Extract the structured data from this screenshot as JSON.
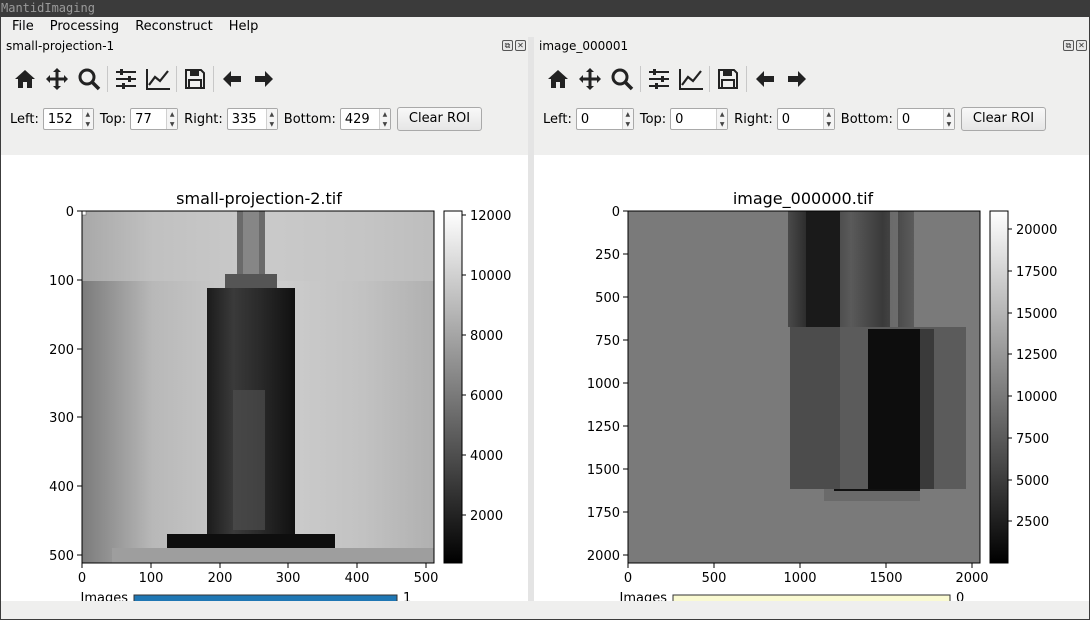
{
  "app_title": "MantidImaging",
  "menu": [
    "File",
    "Processing",
    "Reconstruct",
    "Help"
  ],
  "left": {
    "dock_title": "small-projection-1",
    "roi": {
      "left_label": "Left:",
      "left": "152",
      "top_label": "Top:",
      "top": "77",
      "right_label": "Right:",
      "right": "335",
      "bottom_label": "Bottom:",
      "bottom": "429",
      "clear_label": "Clear ROI"
    },
    "plot_title": "small-projection-2.tif",
    "x_ticks": [
      "0",
      "100",
      "200",
      "300",
      "400",
      "500"
    ],
    "y_ticks": [
      "0",
      "100",
      "200",
      "300",
      "400",
      "500"
    ],
    "cbar_ticks": [
      "12000",
      "10000",
      "8000",
      "6000",
      "4000",
      "2000"
    ],
    "slider_label": "Images",
    "slider_value": "1",
    "slider_color": "#1f77b4"
  },
  "right": {
    "dock_title": "image_000001",
    "roi": {
      "left_label": "Left:",
      "left": "0",
      "top_label": "Top:",
      "top": "0",
      "right_label": "Right:",
      "right": "0",
      "bottom_label": "Bottom:",
      "bottom": "0",
      "clear_label": "Clear ROI"
    },
    "plot_title": "image_000000.tif",
    "x_ticks": [
      "0",
      "500",
      "1000",
      "1500",
      "2000"
    ],
    "y_ticks": [
      "0",
      "250",
      "500",
      "750",
      "1000",
      "1250",
      "1500",
      "1750",
      "2000"
    ],
    "cbar_ticks": [
      "20000",
      "17500",
      "15000",
      "12500",
      "10000",
      "7500",
      "5000",
      "2500"
    ],
    "slider_label": "Images",
    "slider_value": "0",
    "slider_color": "#fafad2"
  },
  "icons": [
    "home-icon",
    "pan-icon",
    "zoom-icon",
    "configure-subplots-icon",
    "edit-axis-icon",
    "save-icon",
    "back-icon",
    "forward-icon"
  ]
}
